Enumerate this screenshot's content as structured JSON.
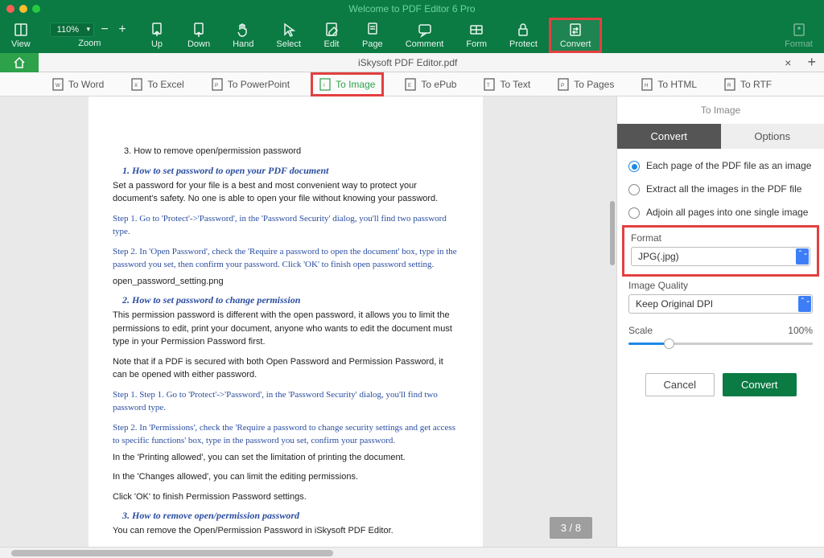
{
  "app_title": "Welcome to PDF Editor 6 Pro",
  "toolbar": {
    "zoom": "110%",
    "items": [
      "View",
      "Zoom",
      "Up",
      "Down",
      "Hand",
      "Select",
      "Edit",
      "Page",
      "Comment",
      "Form",
      "Protect",
      "Convert",
      "Format"
    ]
  },
  "tab": {
    "title": "iSkysoft PDF Editor.pdf"
  },
  "convertbar": [
    "To Word",
    "To Excel",
    "To PowerPoint",
    "To Image",
    "To ePub",
    "To Text",
    "To Pages",
    "To HTML",
    "To RTF"
  ],
  "convertbar_letters": [
    "W",
    "X",
    "P",
    "I",
    "E",
    "T",
    "P",
    "H",
    "R"
  ],
  "page_indicator": "3 / 8",
  "sidebar": {
    "title": "To Image",
    "tabs": {
      "convert": "Convert",
      "options": "Options"
    },
    "radios": [
      "Each page of the PDF file as an image",
      "Extract all the images in the PDF file",
      "Adjoin all pages into one single image"
    ],
    "format_label": "Format",
    "format_value": "JPG(.jpg)",
    "quality_label": "Image Quality",
    "quality_value": "Keep Original DPI",
    "scale_label": "Scale",
    "scale_value": "100%",
    "cancel": "Cancel",
    "convert": "Convert"
  },
  "doc": {
    "l1": "3.    How to remove open/permission password",
    "h1": "1.        How to set password to open your PDF document",
    "p1": "Set a password for your file is a best and most convenient way to protect your document's safety. No one is able to open your file without knowing your password.",
    "s1": "Step 1. Go to 'Protect'->'Password', in the 'Password Security' dialog, you'll find two password type.",
    "s2": "Step 2. In 'Open Password', check the 'Require a password to open the document' box, type in the password you set, then confirm your password. Click 'OK' to finish open password setting.",
    "p2": "open_password_setting.png",
    "h2": "2.        How to set password to change permission",
    "p3": "This permission password is different with the open password, it allows you to limit the permissions to edit, print your document, anyone who wants to edit the document must type in your Permission Password first.",
    "p4": "Note that if a PDF is secured with both Open Password and Permission Password, it can be opened with either password.",
    "s3": "Step 1. Step 1. Go to 'Protect'->'Password', in the 'Password Security' dialog, you'll find two password type.",
    "s4": "Step 2. In 'Permissions', check the 'Require a password to change security settings and get access to specific functions' box, type in the password you set, confirm your password.",
    "p5": "In the 'Printing allowed', you can set the limitation of printing the document.",
    "p6": "In the 'Changes allowed', you can limit the editing permissions.",
    "p7": "Click 'OK' to finish Permission Password settings.",
    "h3": "3.        How to remove open/permission password",
    "p8": "You can remove the Open/Permission Password in iSkysoft PDF Editor."
  }
}
